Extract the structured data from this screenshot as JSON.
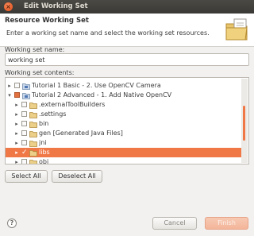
{
  "window": {
    "title": "Edit Working Set"
  },
  "header": {
    "title": "Resource Working Set",
    "description": "Enter a working set name and select the working set resources."
  },
  "name_field": {
    "label": "Working set name:",
    "value": "working set"
  },
  "contents": {
    "label": "Working set contents:",
    "items": [
      {
        "label": "Tutorial 1 Basic - 2. Use OpenCV Camera",
        "arrow": "collapsed",
        "check": "none",
        "icon": "project-icon",
        "level": 0
      },
      {
        "label": "Tutorial 2 Advanced - 1. Add Native OpenCV",
        "arrow": "expanded",
        "check": "partial",
        "icon": "project-icon",
        "level": 0
      },
      {
        "label": ".externalToolBuilders",
        "arrow": "collapsed",
        "check": "none",
        "icon": "folder-icon",
        "level": 1
      },
      {
        "label": ".settings",
        "arrow": "collapsed",
        "check": "none",
        "icon": "folder-icon",
        "level": 1
      },
      {
        "label": "bin",
        "arrow": "collapsed",
        "check": "none",
        "icon": "folder-icon",
        "level": 1
      },
      {
        "label": "gen [Generated Java Files]",
        "arrow": "collapsed",
        "check": "none",
        "icon": "folder-icon",
        "level": 1
      },
      {
        "label": "jni",
        "arrow": "collapsed",
        "check": "none",
        "icon": "folder-icon",
        "level": 1
      },
      {
        "label": "libs",
        "arrow": "collapsed",
        "check": "checked",
        "icon": "folder-icon",
        "level": 1,
        "selected": true
      },
      {
        "label": "obj",
        "arrow": "collapsed",
        "check": "none",
        "icon": "folder-icon",
        "level": 1
      }
    ]
  },
  "buttons": {
    "select_all": "Select All",
    "deselect_all": "Deselect All",
    "cancel": "Cancel",
    "finish": "Finish",
    "help": "?"
  },
  "colors": {
    "accent": "#f07746",
    "title_bar": "#3c3b37"
  }
}
